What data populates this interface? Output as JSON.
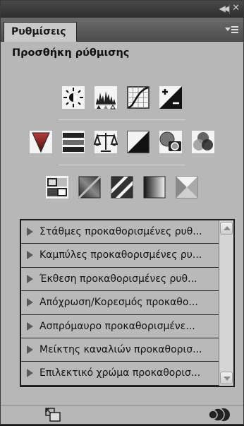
{
  "panel": {
    "tab_label": "Ρυθμίσεις",
    "heading": "Προσθήκη ρύθμισης"
  },
  "titlebar": {
    "collapse_icon": "double-chevron-left-icon",
    "close_icon": "close-icon"
  },
  "adjustment_icons": {
    "row1": [
      "brightness-contrast-icon",
      "levels-icon",
      "curves-icon",
      "exposure-icon"
    ],
    "row2": [
      "vibrance-icon",
      "hue-saturation-icon",
      "color-balance-icon",
      "black-white-icon",
      "photo-filter-icon",
      "channel-mixer-icon"
    ],
    "row3": [
      "invert-icon",
      "posterize-icon",
      "threshold-icon",
      "gradient-map-icon",
      "selective-color-icon"
    ]
  },
  "presets": [
    "Στάθμες προκαθορισμένες ρυθ...",
    "Καμπύλες προκαθορισμένες ρυ...",
    "Έκθεση προκαθορισμένες ρυθ...",
    "Απόχρωση/Κορεσμός προκαθο...",
    "Ασπρόμαυρο προκαθορισμένε...",
    "Μείκτης καναλιών προκαθορισ...",
    "Επιλεκτικό χρώμα προκαθορισ..."
  ],
  "footer": {
    "left_icon": "expand-view-icon",
    "right_icon": "layer-visibility-icon"
  }
}
